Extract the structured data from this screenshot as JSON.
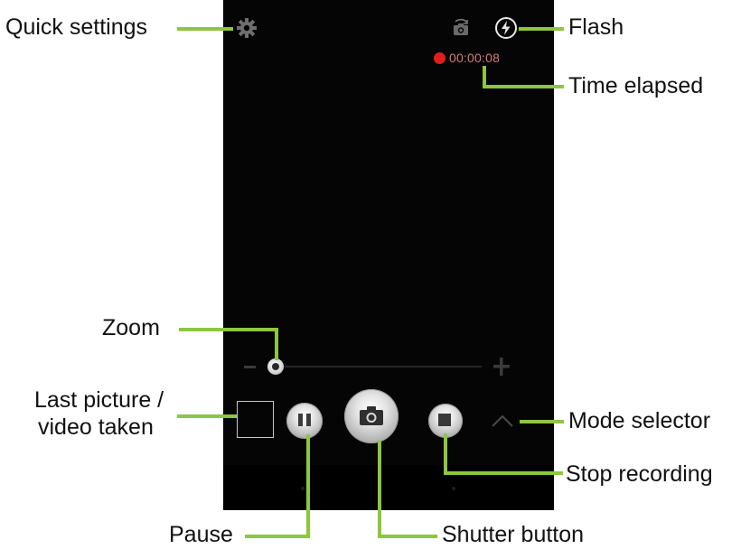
{
  "camera": {
    "timer": "00:00:08",
    "icons": {
      "settings": "gear-icon",
      "switch_camera": "switch-camera-icon",
      "flash": "flash-auto-icon",
      "record_indicator": "red-dot-icon",
      "zoom_out": "minus-icon",
      "zoom_in": "plus-icon",
      "pause": "pause-icon",
      "shutter": "camera-icon",
      "stop": "stop-icon",
      "mode": "chevron-up-icon"
    },
    "zoom_level": 0.0,
    "colors": {
      "background": "#050505",
      "recording_dot": "#e01e1e",
      "timer_text": "#d97a7a",
      "callout_line": "#8dc63f"
    }
  },
  "callouts": {
    "quick_settings": "Quick settings",
    "flash": "Flash",
    "time_elapsed": "Time elapsed",
    "zoom": "Zoom",
    "last_picture_line1": "Last picture /",
    "last_picture_line2": "video taken",
    "mode_selector": "Mode selector",
    "stop_recording": "Stop recording",
    "pause": "Pause",
    "shutter_button": "Shutter button"
  }
}
